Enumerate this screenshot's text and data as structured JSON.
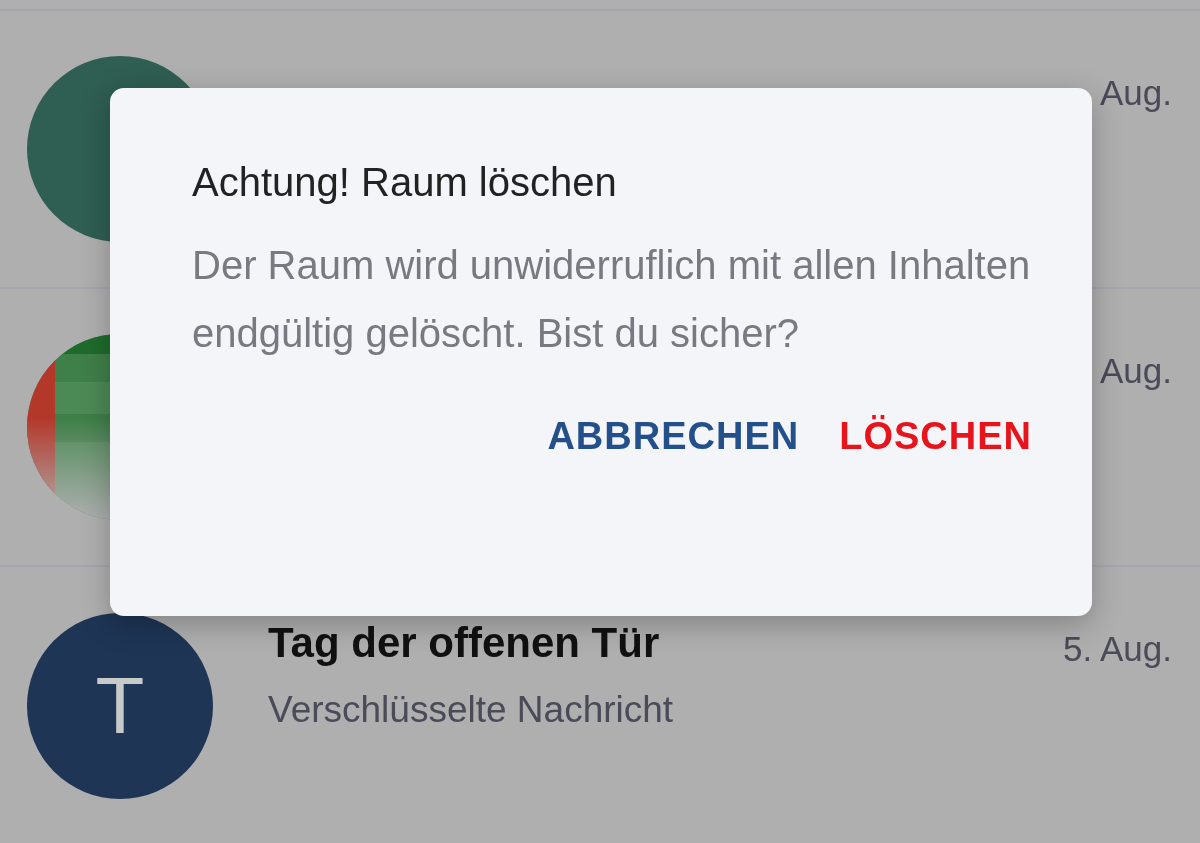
{
  "rooms": [
    {
      "avatar": {
        "kind": "letter",
        "color": "#2f5e52"
      },
      "date": "Aug."
    },
    {
      "date": "Aug."
    },
    {
      "avatar": {
        "kind": "letter",
        "letter": "T",
        "color": "#1e3555"
      },
      "title": "Tag der offenen Tür",
      "date": "5. Aug.",
      "subtitle": "Verschlüsselte Nachricht"
    }
  ],
  "dialog": {
    "title": "Achtung! Raum löschen",
    "message": "Der Raum wird unwiderruflich mit allen Inhalten endgültig gelöscht. Bist du sicher?",
    "buttons": [
      {
        "label": "ABBRECHEN",
        "kind": "cancel"
      },
      {
        "label": "LÖSCHEN",
        "kind": "destructive"
      }
    ]
  }
}
